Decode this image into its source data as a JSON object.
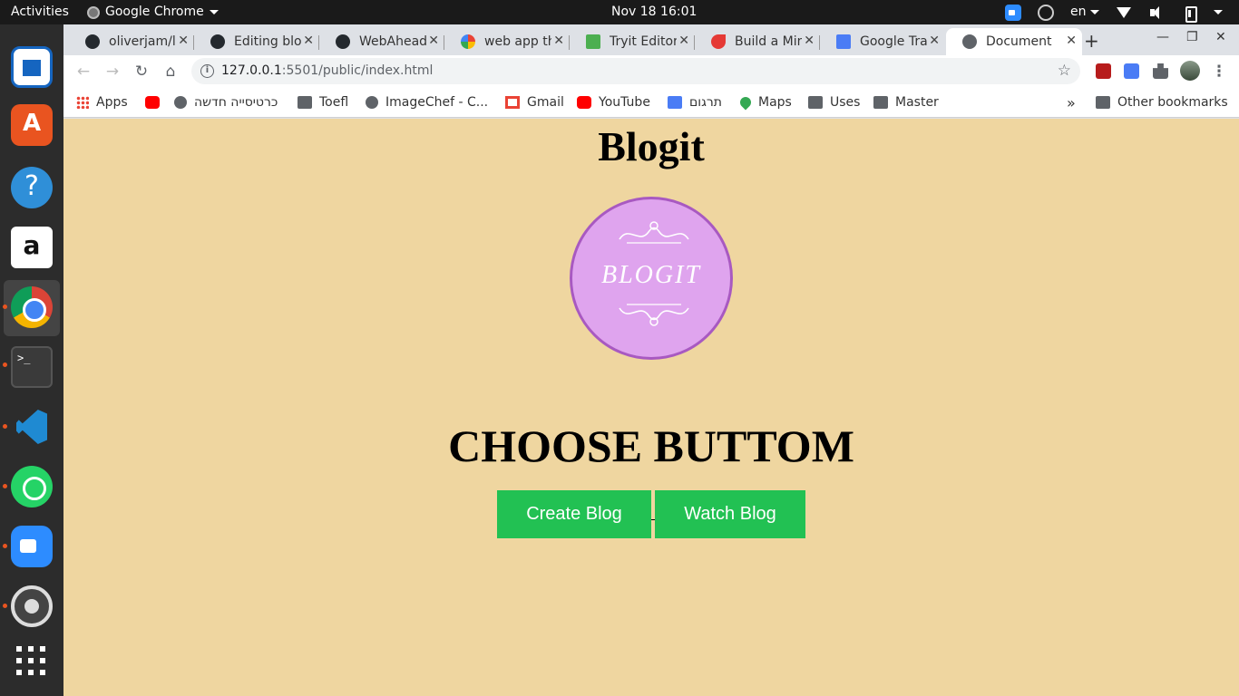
{
  "topbar": {
    "activities": "Activities",
    "app_name": "Google Chrome",
    "clock": "Nov 18  16:01",
    "language": "en"
  },
  "tabs": [
    {
      "title": "oliverjam/l",
      "favicon": "github-icon"
    },
    {
      "title": "Editing blo",
      "favicon": "github-icon"
    },
    {
      "title": "WebAhead",
      "favicon": "github-icon"
    },
    {
      "title": "web app th",
      "favicon": "google-icon"
    },
    {
      "title": "Tryit Editor",
      "favicon": "w3schools-icon"
    },
    {
      "title": "Build a Min",
      "favicon": "rocket-icon"
    },
    {
      "title": "Google Tra",
      "favicon": "google-translate-icon"
    },
    {
      "title": "Document",
      "favicon": "globe-icon"
    }
  ],
  "address": {
    "host": "127.0.0.1",
    "path": ":5501/public/index.html"
  },
  "bookmarks": {
    "items": [
      "Apps",
      "",
      "כרטיסייה חדשה",
      "Toefl",
      "ImageChef - C...",
      "Gmail",
      "YouTube",
      "תרגום",
      "Maps",
      "Uses",
      "Master"
    ],
    "overflow": "»",
    "other": "Other bookmarks"
  },
  "page": {
    "title": "Blogit",
    "logo_text": "BLOGIT",
    "heading": "CHOOSE BUTTOM",
    "create_button": "Create Blog",
    "watch_button": "Watch Blog"
  },
  "colors": {
    "page_background": "#efd6a0",
    "button_green": "#22c153",
    "logo_fill": "#dfa4ee",
    "logo_border": "#a859c1"
  }
}
